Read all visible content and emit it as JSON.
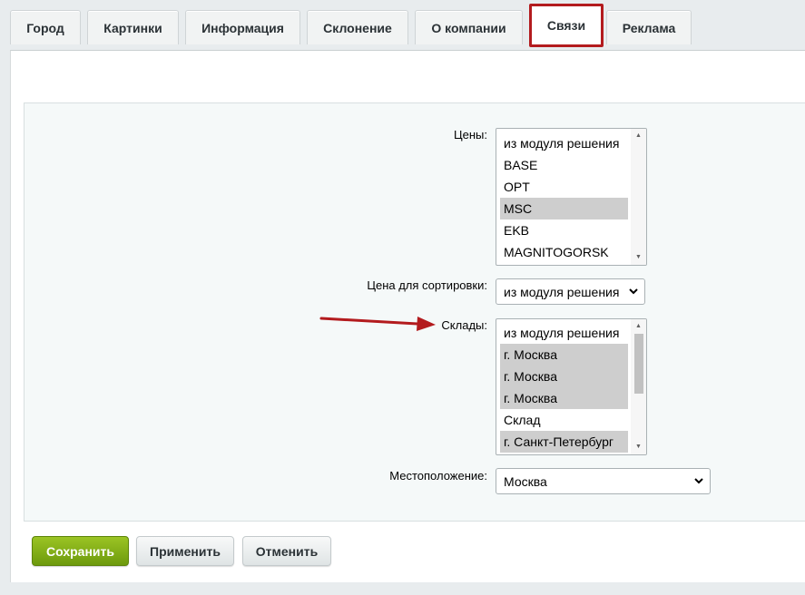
{
  "tabs": [
    {
      "label": "Город",
      "active": false
    },
    {
      "label": "Картинки",
      "active": false
    },
    {
      "label": "Информация",
      "active": false
    },
    {
      "label": "Склонение",
      "active": false
    },
    {
      "label": "О компании",
      "active": false
    },
    {
      "label": "Связи",
      "active": true
    },
    {
      "label": "Реклама",
      "active": false
    }
  ],
  "form": {
    "prices": {
      "label": "Цены:",
      "options": [
        {
          "text": "из модуля решения",
          "selected": false
        },
        {
          "text": "BASE",
          "selected": false
        },
        {
          "text": "OPT",
          "selected": false
        },
        {
          "text": "MSC",
          "selected": true
        },
        {
          "text": "EKB",
          "selected": false
        },
        {
          "text": "MAGNITOGORSK",
          "selected": false
        }
      ]
    },
    "sort_price": {
      "label": "Цена для сортировки:",
      "value": "из модуля решения"
    },
    "warehouses": {
      "label": "Склады:",
      "options": [
        {
          "text": "из модуля решения",
          "selected": false
        },
        {
          "text": "г. Москва",
          "selected": true
        },
        {
          "text": "г. Москва",
          "selected": true
        },
        {
          "text": "г. Москва",
          "selected": true
        },
        {
          "text": "Склад",
          "selected": false
        },
        {
          "text": "г. Санкт-Петербург",
          "selected": true
        }
      ]
    },
    "location": {
      "label": "Местоположение:",
      "value": "Москва"
    }
  },
  "buttons": {
    "save": "Сохранить",
    "apply": "Применить",
    "cancel": "Отменить"
  },
  "colors": {
    "highlight": "#b31b1e",
    "save_button": "#7eaa13",
    "selected_option": "#cecece"
  },
  "icons": {
    "annotation_arrow": "red-arrow-icon",
    "dropdown": "chevron-down-icon"
  }
}
